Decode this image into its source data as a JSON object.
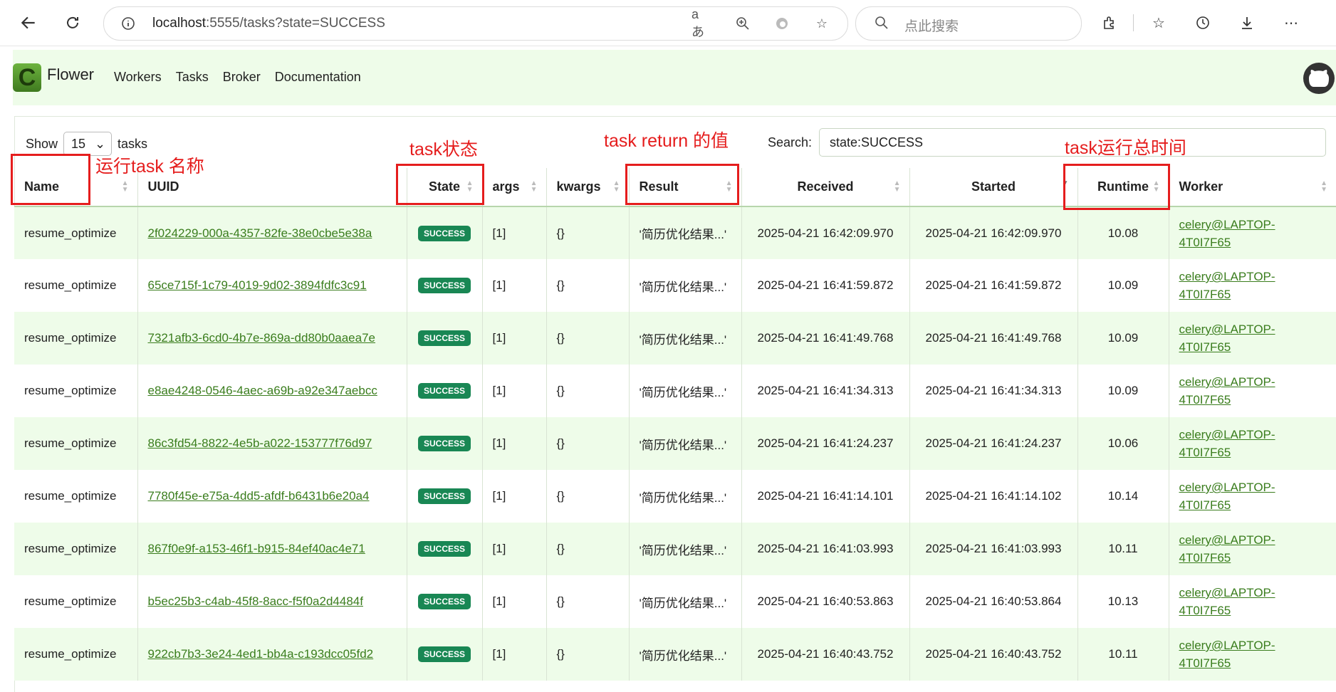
{
  "browser": {
    "url_host": "localhost",
    "url_rest": ":5555/tasks?state=SUCCESS",
    "search_placeholder": "点此搜索"
  },
  "flower": {
    "brand": "Flower",
    "nav": [
      "Workers",
      "Tasks",
      "Broker",
      "Documentation"
    ]
  },
  "controls": {
    "show_label": "Show",
    "page_size": "15",
    "tasks_label": "tasks",
    "search_label": "Search:",
    "search_value": "state:SUCCESS"
  },
  "table": {
    "columns": [
      "Name",
      "UUID",
      "State",
      "args",
      "kwargs",
      "Result",
      "Received",
      "Started",
      "Runtime",
      "Worker"
    ],
    "rows": [
      {
        "name": "resume_optimize",
        "uuid": "2f024229-000a-4357-82fe-38e0cbe5e38a",
        "state": "SUCCESS",
        "args": "[1]",
        "kwargs": "{}",
        "result": "'简历优化结果...'",
        "received": "2025-04-21 16:42:09.970",
        "started": "2025-04-21 16:42:09.970",
        "runtime": "10.08",
        "worker": "celery@LAPTOP-4T0I7F65"
      },
      {
        "name": "resume_optimize",
        "uuid": "65ce715f-1c79-4019-9d02-3894fdfc3c91",
        "state": "SUCCESS",
        "args": "[1]",
        "kwargs": "{}",
        "result": "'简历优化结果...'",
        "received": "2025-04-21 16:41:59.872",
        "started": "2025-04-21 16:41:59.872",
        "runtime": "10.09",
        "worker": "celery@LAPTOP-4T0I7F65"
      },
      {
        "name": "resume_optimize",
        "uuid": "7321afb3-6cd0-4b7e-869a-dd80b0aaea7e",
        "state": "SUCCESS",
        "args": "[1]",
        "kwargs": "{}",
        "result": "'简历优化结果...'",
        "received": "2025-04-21 16:41:49.768",
        "started": "2025-04-21 16:41:49.768",
        "runtime": "10.09",
        "worker": "celery@LAPTOP-4T0I7F65"
      },
      {
        "name": "resume_optimize",
        "uuid": "e8ae4248-0546-4aec-a69b-a92e347aebcc",
        "state": "SUCCESS",
        "args": "[1]",
        "kwargs": "{}",
        "result": "'简历优化结果...'",
        "received": "2025-04-21 16:41:34.313",
        "started": "2025-04-21 16:41:34.313",
        "runtime": "10.09",
        "worker": "celery@LAPTOP-4T0I7F65"
      },
      {
        "name": "resume_optimize",
        "uuid": "86c3fd54-8822-4e5b-a022-153777f76d97",
        "state": "SUCCESS",
        "args": "[1]",
        "kwargs": "{}",
        "result": "'简历优化结果...'",
        "received": "2025-04-21 16:41:24.237",
        "started": "2025-04-21 16:41:24.237",
        "runtime": "10.06",
        "worker": "celery@LAPTOP-4T0I7F65"
      },
      {
        "name": "resume_optimize",
        "uuid": "7780f45e-e75a-4dd5-afdf-b6431b6e20a4",
        "state": "SUCCESS",
        "args": "[1]",
        "kwargs": "{}",
        "result": "'简历优化结果...'",
        "received": "2025-04-21 16:41:14.101",
        "started": "2025-04-21 16:41:14.102",
        "runtime": "10.14",
        "worker": "celery@LAPTOP-4T0I7F65"
      },
      {
        "name": "resume_optimize",
        "uuid": "867f0e9f-a153-46f1-b915-84ef40ac4e71",
        "state": "SUCCESS",
        "args": "[1]",
        "kwargs": "{}",
        "result": "'简历优化结果...'",
        "received": "2025-04-21 16:41:03.993",
        "started": "2025-04-21 16:41:03.993",
        "runtime": "10.11",
        "worker": "celery@LAPTOP-4T0I7F65"
      },
      {
        "name": "resume_optimize",
        "uuid": "b5ec25b3-c4ab-45f8-8acc-f5f0a2d4484f",
        "state": "SUCCESS",
        "args": "[1]",
        "kwargs": "{}",
        "result": "'简历优化结果...'",
        "received": "2025-04-21 16:40:53.863",
        "started": "2025-04-21 16:40:53.864",
        "runtime": "10.13",
        "worker": "celery@LAPTOP-4T0I7F65"
      },
      {
        "name": "resume_optimize",
        "uuid": "922cb7b3-3e24-4ed1-bb4a-c193dcc05fd2",
        "state": "SUCCESS",
        "args": "[1]",
        "kwargs": "{}",
        "result": "'简历优化结果...'",
        "received": "2025-04-21 16:40:43.752",
        "started": "2025-04-21 16:40:43.752",
        "runtime": "10.11",
        "worker": "celery@LAPTOP-4T0I7F65"
      }
    ]
  },
  "annotations": {
    "name": "运行task 名称",
    "state": "task状态",
    "result": "task return 的值",
    "runtime": "task运行总时间"
  },
  "colors": {
    "accent_green": "#198754",
    "row_tint": "#eefce9",
    "annotation_red": "#e51d1d"
  }
}
